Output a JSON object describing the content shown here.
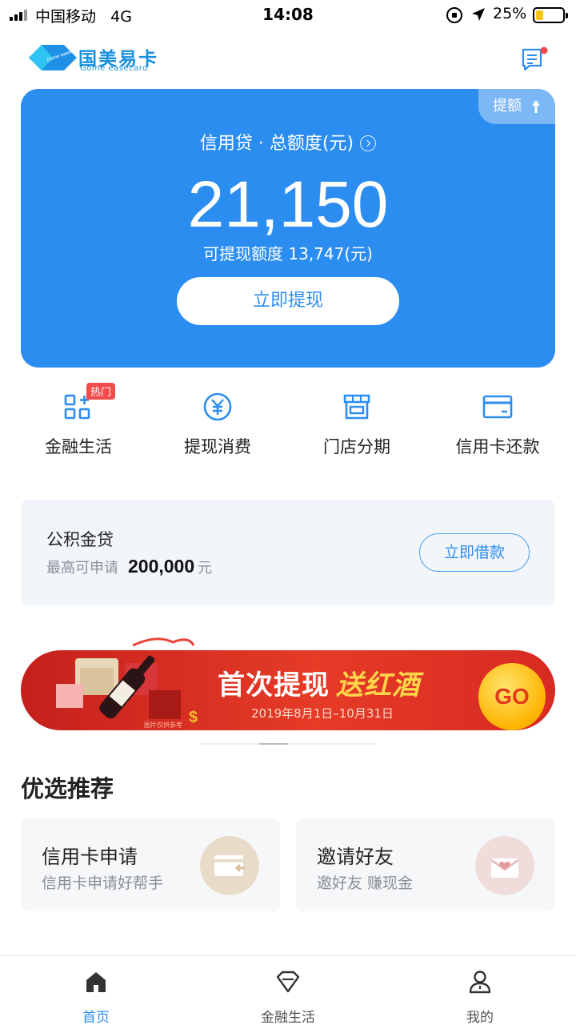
{
  "status_bar": {
    "carrier": "中国移动",
    "network": "4G",
    "time": "14:08",
    "battery": "25%",
    "battery_level": 0.25
  },
  "header": {
    "logo_cn": "国美易卡",
    "logo_en": "Gome easecard",
    "logo_mark_text": "Gome easecard",
    "message_icon": "message-list-icon"
  },
  "credit": {
    "raise_limit": "提额",
    "total_label": "信用贷 · 总额度(元)",
    "total_amount": "21,150",
    "available": "可提现额度 13,747(元)",
    "withdraw_button": "立即提现",
    "color": "#2b8df0"
  },
  "quick_actions": [
    {
      "label": "金融生活",
      "icon": "grid-plus-icon",
      "badge": "热门"
    },
    {
      "label": "提现消费",
      "icon": "yuan-coin-icon"
    },
    {
      "label": "门店分期",
      "icon": "store-icon"
    },
    {
      "label": "信用卡还款",
      "icon": "credit-card-icon"
    }
  ],
  "loan": {
    "title": "公积金贷",
    "max_label": "最高可申请",
    "max_amount": "200,000",
    "unit": "元",
    "button": "立即借款"
  },
  "banner": {
    "title": "首次提现",
    "highlight": "送红酒",
    "date_range": "2019年8月1日–10月31日",
    "go": "GO",
    "note": "图片仅供参考"
  },
  "recommend": {
    "title": "优选推荐",
    "items": [
      {
        "title": "信用卡申请",
        "subtitle": "信用卡申请好帮手",
        "icon": "card-apply-icon"
      },
      {
        "title": "邀请好友",
        "subtitle": "邀好友 赚现金",
        "icon": "invite-envelope-icon"
      }
    ]
  },
  "tab_bar": {
    "tabs": [
      {
        "label": "首页",
        "icon": "home-icon",
        "active": true
      },
      {
        "label": "金融生活",
        "icon": "diamond-icon",
        "active": false
      },
      {
        "label": "我的",
        "icon": "user-icon",
        "active": false
      }
    ]
  }
}
